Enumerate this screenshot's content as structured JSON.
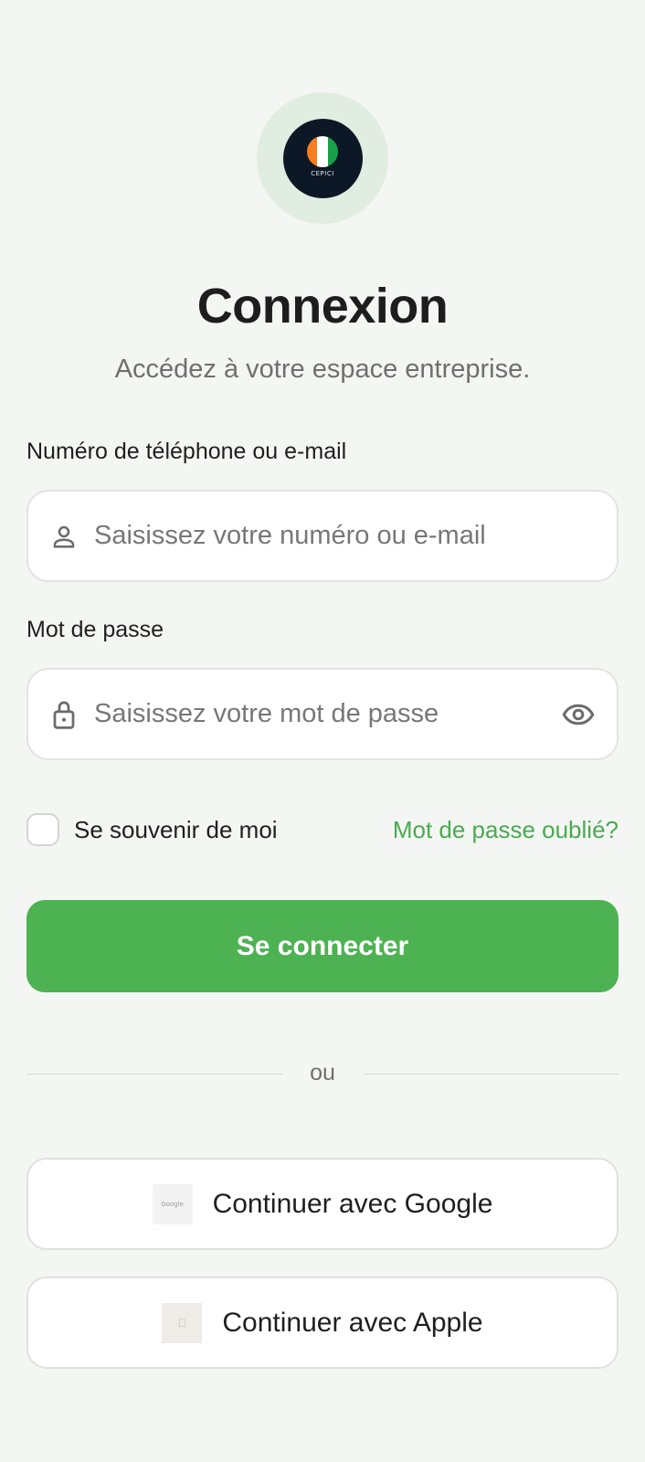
{
  "logo": {
    "text": "CEPICI",
    "flag_colors": [
      "#f47e20",
      "#ffffff",
      "#1aa04a"
    ]
  },
  "header": {
    "title": "Connexion",
    "subtitle": "Accédez à votre espace entreprise."
  },
  "form": {
    "identifier": {
      "label": "Numéro de téléphone ou e-mail",
      "placeholder": "Saisissez votre numéro ou e-mail",
      "value": "",
      "icon": "person-icon"
    },
    "password": {
      "label": "Mot de passe",
      "placeholder": "Saisissez votre mot de passe",
      "value": "",
      "icon": "lock-icon",
      "toggle_icon": "eye-icon"
    },
    "remember_label": "Se souvenir de moi",
    "remember_checked": false,
    "forgot_label": "Mot de passe oublié?",
    "submit_label": "Se connecter"
  },
  "divider": {
    "label": "ou"
  },
  "social": {
    "google_label": "Continuer avec Google",
    "google_thumb_text": "Google",
    "apple_label": "Continuer avec Apple"
  },
  "colors": {
    "accent": "#4db251",
    "link": "#4aa952",
    "background": "#f4f6f3",
    "logo_halo": "#e1ede0",
    "logo_disc": "#0c1826"
  }
}
